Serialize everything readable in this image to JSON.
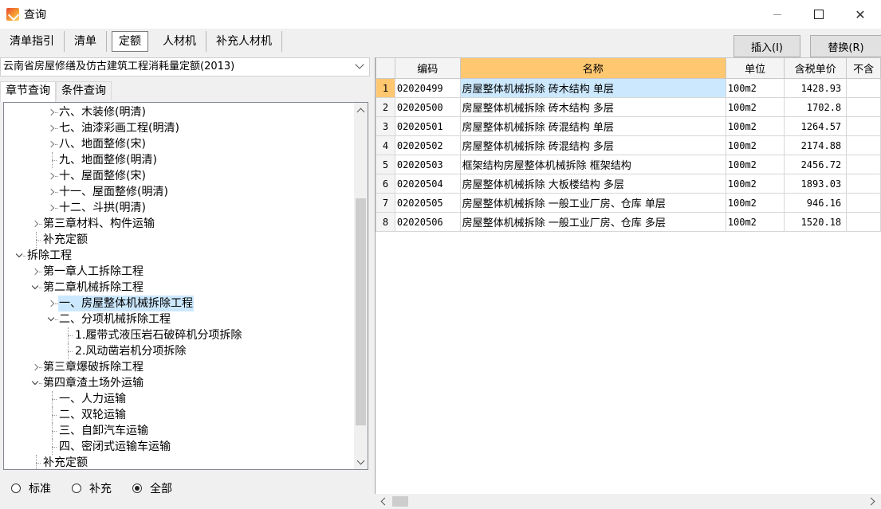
{
  "window": {
    "title": "查询",
    "minimize_icon": "minimize-icon",
    "maximize_icon": "maximize-icon",
    "close_glyph": "✕"
  },
  "top_tabs": [
    {
      "label": "清单指引",
      "active": false
    },
    {
      "label": "清单",
      "active": false
    },
    {
      "label": "定额",
      "active": true
    },
    {
      "label": "人材机",
      "active": false
    },
    {
      "label": "补充人材机",
      "active": false
    }
  ],
  "actions": {
    "insert_label": "插入(I)",
    "replace_label": "替换(R)"
  },
  "quota_library": {
    "selected": "云南省房屋修缮及仿古建筑工程消耗量定额(2013)"
  },
  "left_tabs": [
    {
      "label": "章节查询",
      "active": true
    },
    {
      "label": "条件查询",
      "active": false
    }
  ],
  "tree": [
    {
      "label": "六、木装修(明清)",
      "level": 3,
      "state": "closed"
    },
    {
      "label": "七、油漆彩画工程(明清)",
      "level": 3,
      "state": "closed"
    },
    {
      "label": "八、地面整修(宋)",
      "level": 3,
      "state": "closed"
    },
    {
      "label": "九、地面整修(明清)",
      "level": 3,
      "state": "leaf"
    },
    {
      "label": "十、屋面整修(宋)",
      "level": 3,
      "state": "closed"
    },
    {
      "label": "十一、屋面整修(明清)",
      "level": 3,
      "state": "closed"
    },
    {
      "label": "十二、斗拱(明清)",
      "level": 3,
      "state": "closed"
    },
    {
      "label": "第三章材料、构件运输",
      "level": 2,
      "state": "closed"
    },
    {
      "label": "补充定额",
      "level": 2,
      "state": "leaf"
    },
    {
      "label": "拆除工程",
      "level": 1,
      "state": "open"
    },
    {
      "label": "第一章人工拆除工程",
      "level": 2,
      "state": "closed"
    },
    {
      "label": "第二章机械拆除工程",
      "level": 2,
      "state": "open"
    },
    {
      "label": "一、房屋整体机械拆除工程",
      "level": 3,
      "state": "closed",
      "selected": true
    },
    {
      "label": "二、分项机械拆除工程",
      "level": 3,
      "state": "open"
    },
    {
      "label": "1.履带式液压岩石破碎机分项拆除",
      "level": 4,
      "state": "leaf"
    },
    {
      "label": "2.风动凿岩机分项拆除",
      "level": 4,
      "state": "leaf"
    },
    {
      "label": "第三章爆破拆除工程",
      "level": 2,
      "state": "closed"
    },
    {
      "label": "第四章渣土场外运输",
      "level": 2,
      "state": "open"
    },
    {
      "label": "一、人力运输",
      "level": 3,
      "state": "leaf"
    },
    {
      "label": "二、双轮运输",
      "level": 3,
      "state": "leaf"
    },
    {
      "label": "三、自卸汽车运输",
      "level": 3,
      "state": "leaf"
    },
    {
      "label": "四、密闭式运输车运输",
      "level": 3,
      "state": "leaf"
    },
    {
      "label": "补充定额",
      "level": 2,
      "state": "leaf"
    }
  ],
  "filter": {
    "options": [
      "标准",
      "补充",
      "全部"
    ],
    "selected": "全部"
  },
  "grid": {
    "columns": [
      "",
      "编码",
      "名称",
      "单位",
      "含税单价",
      "不含"
    ],
    "rows": [
      {
        "no": "1",
        "code": "02020499",
        "name": "房屋整体机械拆除 砖木结构 单层",
        "unit": "100m2",
        "price": "1428.93"
      },
      {
        "no": "2",
        "code": "02020500",
        "name": "房屋整体机械拆除 砖木结构 多层",
        "unit": "100m2",
        "price": "1702.8"
      },
      {
        "no": "3",
        "code": "02020501",
        "name": "房屋整体机械拆除 砖混结构 单层",
        "unit": "100m2",
        "price": "1264.57"
      },
      {
        "no": "4",
        "code": "02020502",
        "name": "房屋整体机械拆除 砖混结构 多层",
        "unit": "100m2",
        "price": "2174.88"
      },
      {
        "no": "5",
        "code": "02020503",
        "name": "框架结构房屋整体机械拆除 框架结构",
        "unit": "100m2",
        "price": "2456.72"
      },
      {
        "no": "6",
        "code": "02020504",
        "name": "房屋整体机械拆除 大板楼结构 多层",
        "unit": "100m2",
        "price": "1893.03"
      },
      {
        "no": "7",
        "code": "02020505",
        "name": "房屋整体机械拆除 一般工业厂房、仓库 单层",
        "unit": "100m2",
        "price": "946.16"
      },
      {
        "no": "8",
        "code": "02020506",
        "name": "房屋整体机械拆除 一般工业厂房、仓库 多层",
        "unit": "100m2",
        "price": "1520.18"
      }
    ]
  }
}
